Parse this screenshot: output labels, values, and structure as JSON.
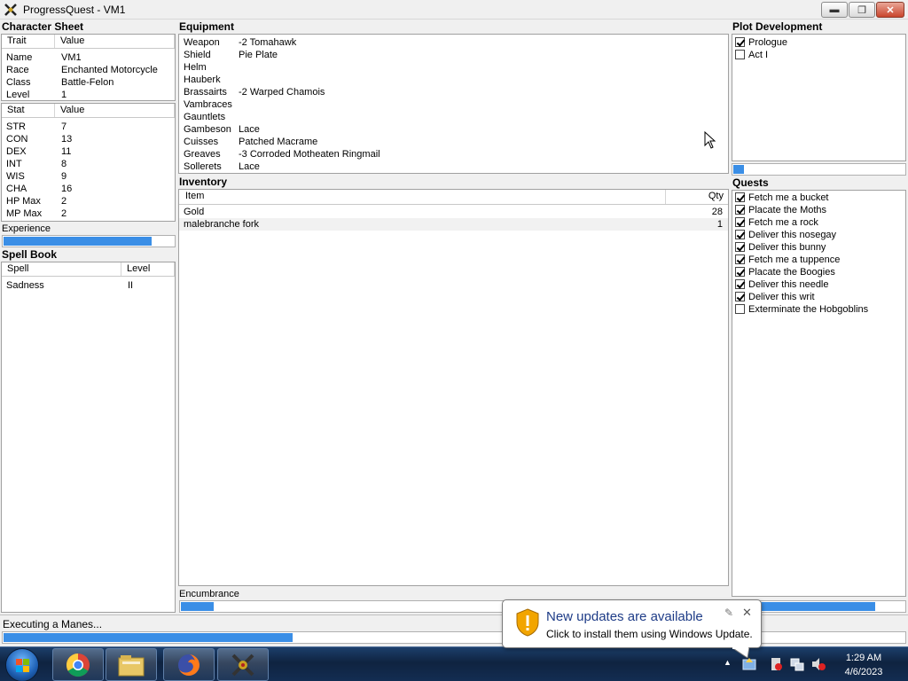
{
  "window": {
    "title": "ProgressQuest - VM1"
  },
  "character_sheet": {
    "heading": "Character Sheet",
    "trait_headers": [
      "Trait",
      "Value"
    ],
    "traits": [
      {
        "k": "Name",
        "v": "VM1"
      },
      {
        "k": "Race",
        "v": "Enchanted Motorcycle"
      },
      {
        "k": "Class",
        "v": "Battle-Felon"
      },
      {
        "k": "Level",
        "v": "1"
      }
    ],
    "stat_headers": [
      "Stat",
      "Value"
    ],
    "stats": [
      {
        "k": "STR",
        "v": "7"
      },
      {
        "k": "CON",
        "v": "13"
      },
      {
        "k": "DEX",
        "v": "11"
      },
      {
        "k": "INT",
        "v": "8"
      },
      {
        "k": "WIS",
        "v": "9"
      },
      {
        "k": "CHA",
        "v": "16"
      },
      {
        "k": "HP Max",
        "v": "2"
      },
      {
        "k": "MP Max",
        "v": "2"
      }
    ],
    "experience_label": "Experience",
    "experience_progress": 0.86
  },
  "spell_book": {
    "heading": "Spell Book",
    "headers": [
      "Spell",
      "Level"
    ],
    "spells": [
      {
        "k": "Sadness",
        "v": "II"
      }
    ]
  },
  "equipment": {
    "heading": "Equipment",
    "items": [
      {
        "slot": "Weapon",
        "item": "-2 Tomahawk"
      },
      {
        "slot": "Shield",
        "item": "Pie Plate"
      },
      {
        "slot": "Helm",
        "item": ""
      },
      {
        "slot": "Hauberk",
        "item": ""
      },
      {
        "slot": "Brassairts",
        "item": "-2 Warped Chamois"
      },
      {
        "slot": "Vambraces",
        "item": ""
      },
      {
        "slot": "Gauntlets",
        "item": ""
      },
      {
        "slot": "Gambeson",
        "item": "Lace"
      },
      {
        "slot": "Cuisses",
        "item": "Patched Macrame"
      },
      {
        "slot": "Greaves",
        "item": "-3 Corroded Motheaten Ringmail"
      },
      {
        "slot": "Sollerets",
        "item": "Lace"
      }
    ]
  },
  "inventory": {
    "heading": "Inventory",
    "headers": [
      "Item",
      "Qty"
    ],
    "items": [
      {
        "item": "Gold",
        "qty": "28"
      },
      {
        "item": "malebranche fork",
        "qty": "1"
      }
    ],
    "encumbrance_label": "Encumbrance",
    "encumbrance_progress": 0.06
  },
  "plot": {
    "heading": "Plot Development",
    "acts": [
      {
        "label": "Prologue",
        "done": true
      },
      {
        "label": "Act I",
        "done": false
      }
    ],
    "progress": 0.06
  },
  "quests": {
    "heading": "Quests",
    "items": [
      {
        "label": "Fetch me a bucket",
        "done": true
      },
      {
        "label": "Placate the Moths",
        "done": true
      },
      {
        "label": "Fetch me a rock",
        "done": true
      },
      {
        "label": "Deliver this nosegay",
        "done": true
      },
      {
        "label": "Deliver this bunny",
        "done": true
      },
      {
        "label": "Fetch me a tuppence",
        "done": true
      },
      {
        "label": "Placate the Boogies",
        "done": true
      },
      {
        "label": "Deliver this needle",
        "done": true
      },
      {
        "label": "Deliver this writ",
        "done": true
      },
      {
        "label": "Exterminate the Hobgoblins",
        "done": false
      }
    ],
    "progress": 0.82
  },
  "status": {
    "text": "Executing a Manes...",
    "progress": 0.32
  },
  "notification": {
    "title": "New updates are available",
    "body": "Click to install them using Windows Update."
  },
  "taskbar": {
    "time": "1:29 AM",
    "date": "4/6/2023",
    "apps": [
      "chrome-icon",
      "folder-icon",
      "firefox-icon",
      "progressquest-icon"
    ]
  },
  "colors": {
    "accent": "#3a8ee6",
    "taskbar": "#132d52"
  }
}
